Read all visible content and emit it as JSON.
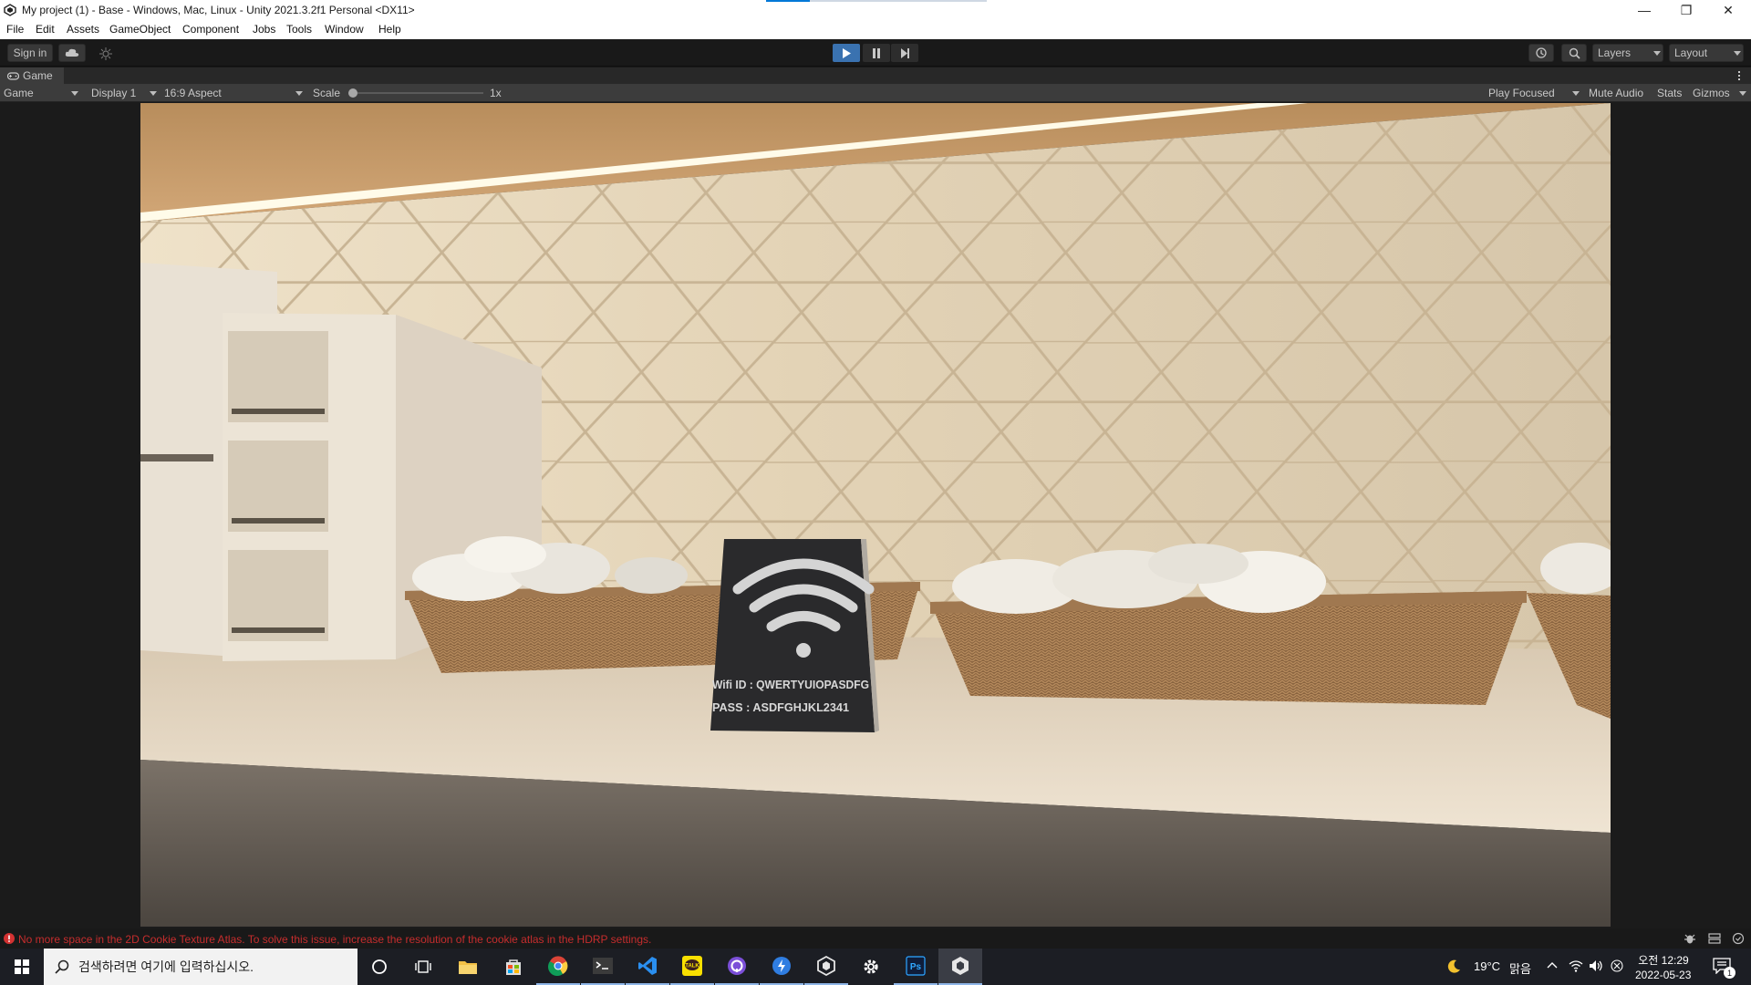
{
  "window": {
    "title": "My project (1) - Base - Windows, Mac, Linux - Unity 2021.3.2f1 Personal <DX11>",
    "minimize_glyph": "—",
    "restore_glyph": "❐",
    "close_glyph": "✕"
  },
  "menu": {
    "items": [
      "File",
      "Edit",
      "Assets",
      "GameObject",
      "Component",
      "Jobs",
      "Tools",
      "Window",
      "Help"
    ]
  },
  "toolbar": {
    "sign_in_label": "Sign in",
    "layers_label": "Layers",
    "layout_label": "Layout",
    "play_active_color": "#3a72b0"
  },
  "game_view": {
    "tab_label": "Game",
    "mode_label": "Game",
    "display_label": "Display 1",
    "aspect_label": "16:9 Aspect",
    "scale_label": "Scale",
    "scale_value": "1x",
    "scale_fraction": 0.0,
    "play_focused_label": "Play Focused",
    "mute_audio_label": "Mute Audio",
    "stats_label": "Stats",
    "gizmos_label": "Gizmos"
  },
  "scene": {
    "sign_wifi_id": "Wifi ID : QWERTYUIOPASDFG",
    "sign_pass": "PASS : ASDFGHJKL2341"
  },
  "status": {
    "error_message": "No more space in the 2D Cookie Texture Atlas. To solve this issue, increase the resolution of the cookie atlas in the HDRP settings.",
    "error_color": "#c62d2d"
  },
  "taskbar": {
    "search_placeholder": "검색하려면 여기에 입력하십시오.",
    "weather_temp": "19°C",
    "weather_desc": "맑음",
    "time_period": "오전 12:29",
    "date": "2022-05-23",
    "notification_count": "1"
  }
}
